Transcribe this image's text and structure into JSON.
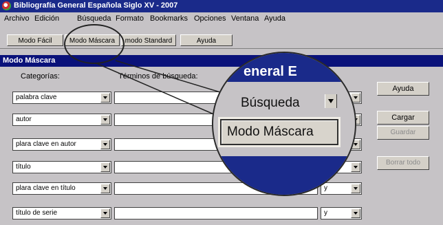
{
  "window": {
    "title": "Bibliografía General Española Siglo XV - 2007"
  },
  "menu": {
    "items": [
      "Archivo",
      "Edición",
      "Búsqueda",
      "Formato",
      "Bookmarks",
      "Opciones",
      "Ventana",
      "Ayuda"
    ]
  },
  "toolbar": {
    "buttons": [
      "Modo Fácil",
      "Modo Máscara",
      "modo Standard",
      "Ayuda"
    ]
  },
  "panel": {
    "title": "Modo Máscara",
    "col_categories": "Categorías:",
    "col_terms": "Términos de búsqueda:",
    "rows": [
      {
        "category": "palabra clave",
        "term": "",
        "operator": ""
      },
      {
        "category": "autor",
        "term": "",
        "operator": ""
      },
      {
        "category": "plara clave en autor",
        "term": "",
        "operator": ""
      },
      {
        "category": "título",
        "term": "",
        "operator": ""
      },
      {
        "category": "plara clave en título",
        "term": "",
        "operator": "y"
      },
      {
        "category": "título de serie",
        "term": "",
        "operator": "y"
      }
    ],
    "buttons": {
      "help": "Ayuda",
      "load": "Cargar",
      "save": "Guardar",
      "delete": "Borrar todo"
    }
  },
  "magnifier": {
    "band_text": "eneral E",
    "search_label": "Búsqueda",
    "mask_label": "Modo Máscara"
  },
  "colors": {
    "titlebar": "#1a2a8a",
    "panel_header": "#0a127a",
    "face": "#c6c3c6"
  }
}
